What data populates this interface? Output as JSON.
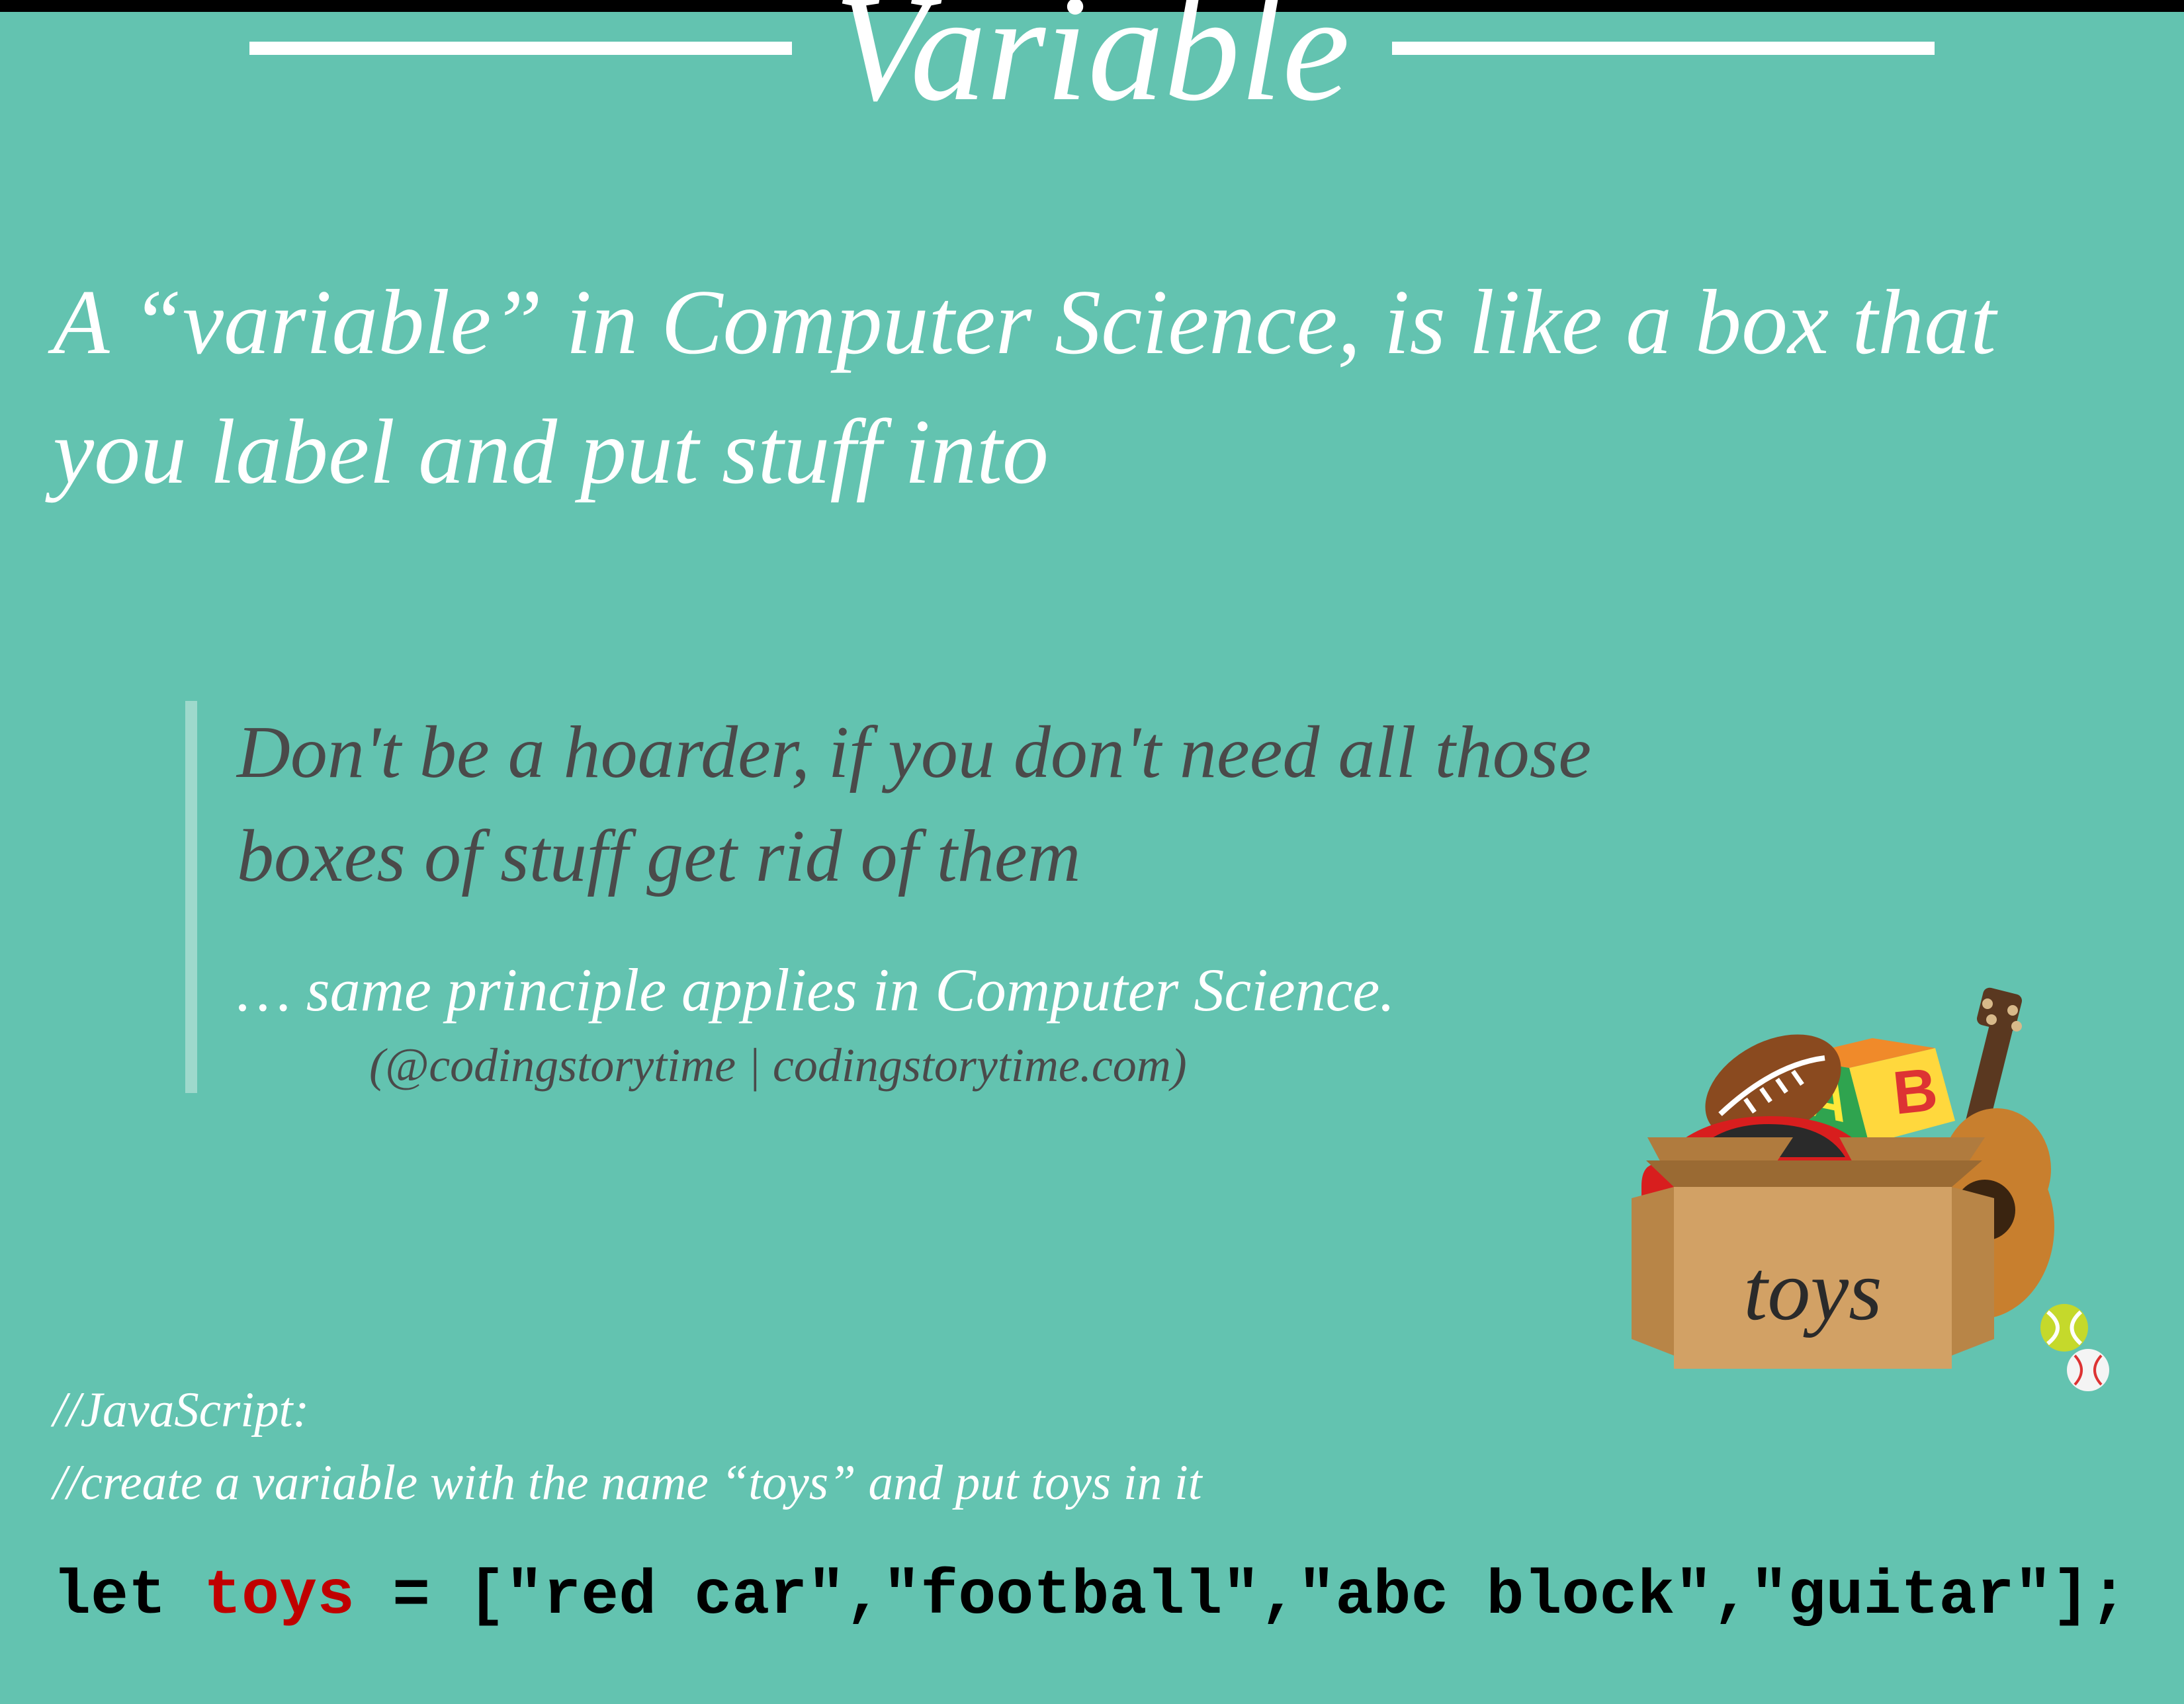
{
  "title": "Variable",
  "subtitle": "A “variable” in Computer Science, is like a box that you label and put stuff into",
  "quote": {
    "main": "Don't be a hoarder, if you don't need all those boxes of stuff get rid of them",
    "sub": "… same principle applies in Computer Science.",
    "credit": "(@codingstorytime | codingstorytime.com)"
  },
  "box_label": "toys",
  "comments": {
    "line1": "//JavaScript:",
    "line2": "//create a variable with the name “toys” and put toys in it"
  },
  "code": {
    "keyword": "let ",
    "varname": "toys",
    "rest": " = [\"red car\",\"football\",\"abc block\",\"guitar\"];"
  }
}
